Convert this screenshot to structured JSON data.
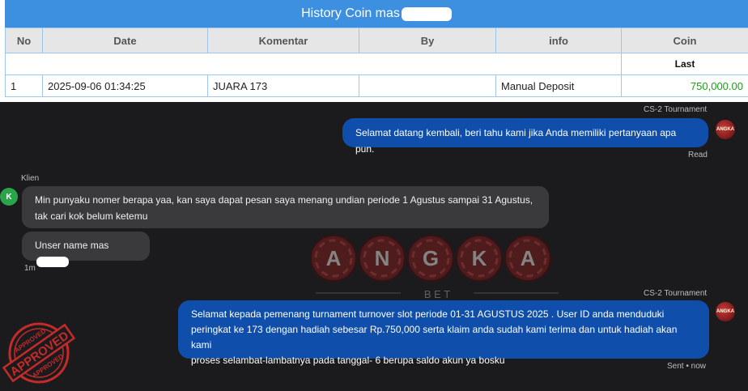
{
  "coin_history": {
    "title": "History Coin mas",
    "columns": [
      "No",
      "Date",
      "Komentar",
      "By",
      "info",
      "Coin"
    ],
    "last_label": "Last",
    "rows": [
      {
        "no": "1",
        "date": "2025-09-06 01:34:25",
        "komentar": "JUARA 173",
        "by": "",
        "info": "Manual Deposit",
        "coin": "750,000.00"
      }
    ]
  },
  "chat": {
    "messages": [
      {
        "sender": "CS-2 Tournament",
        "text": "Selamat datang kembali, beri tahu kami jika Anda memiliki pertanyaan apa pun.",
        "status": "Read"
      },
      {
        "sender": "Klien",
        "text_line1": "Min punyaku nomer berapa yaa, kan saya dapat pesan saya menang undian periode 1 Agustus sampai 31 Agustus,",
        "text_line2": "tak cari kok belum ketemu"
      },
      {
        "text": "Unser name mas",
        "time": "1m"
      },
      {
        "sender": "CS-2 Tournament",
        "text_line1": "Selamat kepada pemenang turnament turnover slot periode 01-31 AGUSTUS 2025 . User ID anda menduduki",
        "text_line2": "peringkat ke 173 dengan hadiah sebesar Rp.750,000 serta klaim anda sudah kami terima dan untuk hadiah akan kami",
        "text_line3": "proses selambat-lambatnya pada tanggal- 6 berupa saldo akun ya bosku",
        "status": "Sent • now"
      }
    ],
    "client_initial": "K",
    "agent_avatar_text": "ANGKA"
  },
  "watermark": {
    "letters": [
      "A",
      "N",
      "G",
      "K",
      "A"
    ],
    "sub": "B E T"
  },
  "stamp": {
    "text": "APPROVED"
  },
  "colors": {
    "title_bar": "#3d8fe0",
    "bubble_out": "#0f4eaa",
    "bubble_in": "#3a3a3d",
    "amount_green": "#1aa01a"
  }
}
